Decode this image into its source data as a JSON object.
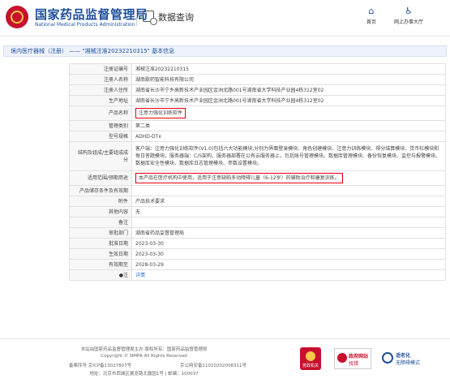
{
  "header": {
    "site_name": "国家药品监督管理局",
    "site_name_en": "National Medical Products Administration",
    "section_title": "数据查询",
    "nav": [
      {
        "label": "首页",
        "icon": "home-icon"
      },
      {
        "label": "网上办事大厅",
        "icon": "person-icon"
      }
    ]
  },
  "breadcrumb": "境内医疗器械（注册） —— \"湘械注准20232210315\" 基本信息",
  "rows": [
    {
      "label": "注册证编号",
      "value": "湘械注准20232210315"
    },
    {
      "label": "注册人名称",
      "value": "湖南歌药智能科技有限公司"
    },
    {
      "label": "注册人住所",
      "value": "湖南省长沙市宁乡高新技术产业园区金洲北路001号湖南省大学科技产业园4栋312室02"
    },
    {
      "label": "生产地址",
      "value": "湖南省长沙市宁乡高新技术产业园区金洲北路001号湖南省大学科技产业园4栋312室02"
    },
    {
      "label": "产品名称",
      "value": "注意力强化训练软件",
      "highlight": true
    },
    {
      "label": "管理类别",
      "value": "第二类"
    },
    {
      "label": "型号规格",
      "value": "ADHD-DTx"
    },
    {
      "label": "结构及组成/主要组成成分",
      "value": "客户端：注意力强化训练软件(V1.0)包括六大功能模块,分别为界面登录模块、角色创建模块、注意力训练模块、得分结算模块、货币栏模块和每日答题模块。服务器端：C/S架构，服务器部署在公有云服务器上，包括账号管理模块、数据库管理模块、备份恢复模块、监控与报警模块、数据库安全性模块、数据库日志管理模块、参数设置模块。"
    },
    {
      "label": "适用范围/预期用途",
      "value": "本产品在医疗机构中使用，适用于注意缺陷多动障碍儿童（6-12岁）的辅助治疗和康复训练。",
      "highlight": true
    },
    {
      "label": "产品储存条件及有效期",
      "value": ""
    },
    {
      "label": "附件",
      "value": "产品技术要求"
    },
    {
      "label": "其他内容",
      "value": "无"
    },
    {
      "label": "备注",
      "value": ""
    },
    {
      "label": "审批部门",
      "value": "湖南省药品监督管理局"
    },
    {
      "label": "批准日期",
      "value": "2023-03-30"
    },
    {
      "label": "生效日期",
      "value": "2023-03-30"
    },
    {
      "label": "有效期至",
      "value": "2028-03-29"
    },
    {
      "label": "注",
      "value": "详情",
      "icon": "location-pin-icon",
      "link": true
    }
  ],
  "footer": {
    "lines": [
      "本站由国家药品监督管理局主办 版权所有：国家药品监督管理局",
      "Copyright © NMPA All Rights Reserved",
      "备案序号:京ICP备13027807号",
      "京公网安备11010202008311号",
      "地址：北京市西城区展览路北露园1号 | 邮编：100037"
    ],
    "badges": {
      "party": "党政机关",
      "gov_t1": "政府网站",
      "gov_t2": "找错",
      "age_t1": "适老化",
      "age_t2": "无障碍模式"
    }
  }
}
